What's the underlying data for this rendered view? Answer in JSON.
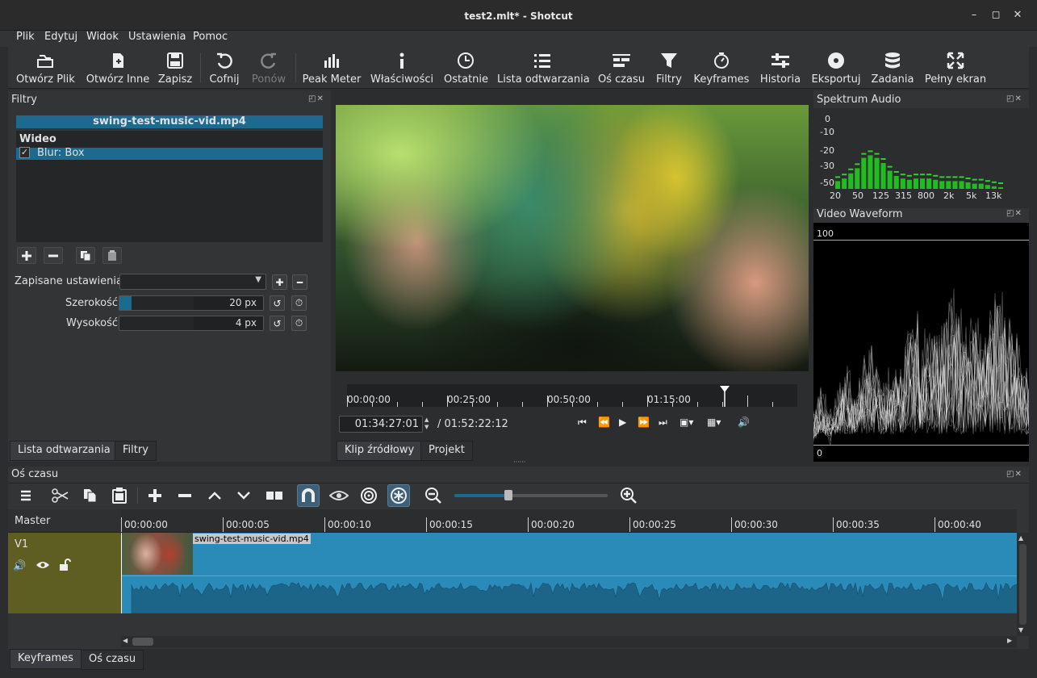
{
  "window": {
    "title": "test2.mlt* - Shotcut",
    "controls": [
      "–",
      "◻",
      "✕"
    ]
  },
  "menu": [
    "Plik",
    "Edytuj",
    "Widok",
    "Ustawienia",
    "Pomoc"
  ],
  "toolbar": [
    {
      "label": "Otwórz Plik",
      "icon": "open-file-icon"
    },
    {
      "label": "Otwórz Inne",
      "icon": "open-other-icon"
    },
    {
      "label": "Zapisz",
      "icon": "save-icon"
    },
    {
      "label": "Cofnij",
      "icon": "undo-icon"
    },
    {
      "label": "Ponów",
      "icon": "redo-icon",
      "disabled": true
    },
    {
      "label": "Peak Meter",
      "icon": "peak-meter-icon"
    },
    {
      "label": "Właściwości",
      "icon": "properties-icon"
    },
    {
      "label": "Ostatnie",
      "icon": "recent-icon"
    },
    {
      "label": "Lista odtwarzania",
      "icon": "playlist-icon"
    },
    {
      "label": "Oś czasu",
      "icon": "timeline-icon"
    },
    {
      "label": "Filtry",
      "icon": "filter-icon"
    },
    {
      "label": "Keyframes",
      "icon": "keyframes-icon"
    },
    {
      "label": "Historia",
      "icon": "history-icon"
    },
    {
      "label": "Eksportuj",
      "icon": "export-icon"
    },
    {
      "label": "Zadania",
      "icon": "jobs-icon"
    },
    {
      "label": "Pełny ekran",
      "icon": "fullscreen-icon"
    }
  ],
  "filters": {
    "title": "Filtry",
    "clip_name": "swing-test-music-vid.mp4",
    "group": "Wideo",
    "items": [
      {
        "label": "Blur: Box",
        "checked": true
      }
    ],
    "presets_label": "Zapisane ustawienia",
    "width_label": "Szerokość",
    "width_value": "20 px",
    "width_fraction": 0.08,
    "height_label": "Wysokość",
    "height_value": "4 px",
    "height_fraction": 0.0
  },
  "left_tabs": [
    "Lista odtwarzania",
    "Filtry"
  ],
  "player": {
    "ruler": [
      "00:00:00",
      "00:25:00",
      "00:50:00",
      "01:15:00"
    ],
    "current_time": "01:34:27:01",
    "total_time": "/ 01:52:22:12",
    "tabs": [
      "Klip źródłowy",
      "Projekt"
    ]
  },
  "spectrum": {
    "title": "Spektrum Audio",
    "db_labels": [
      "0",
      "-10",
      "-20",
      "-30",
      "-50"
    ],
    "freq_labels": [
      "20",
      "50",
      "125",
      "315",
      "800",
      "2k",
      "5k",
      "13k"
    ],
    "bars": [
      -46,
      -44,
      -40,
      -36,
      -28,
      -26,
      -28,
      -32,
      -38,
      -42,
      -44,
      -45,
      -44,
      -44,
      -44,
      -45,
      -46,
      -46,
      -46,
      -46,
      -47,
      -48,
      -48,
      -49,
      -50,
      -51
    ]
  },
  "waveform": {
    "title": "Video Waveform",
    "top_label": "100",
    "bottom_label": "0"
  },
  "timeline": {
    "title": "Oś czasu",
    "ruler": [
      "00:00:00",
      "00:00:05",
      "00:00:10",
      "00:00:15",
      "00:00:20",
      "00:00:25",
      "00:00:30",
      "00:00:35",
      "00:00:40"
    ],
    "master_label": "Master",
    "track_label": "V1",
    "clip_name": "swing-test-music-vid.mp4",
    "zoom_fraction": 0.35
  },
  "bottom_tabs": [
    "Keyframes",
    "Oś czasu"
  ],
  "colors": {
    "accent": "#1d6a90",
    "track": "#5e5e22",
    "clip": "#2a8ab8",
    "spectrum": "#22bb22"
  }
}
